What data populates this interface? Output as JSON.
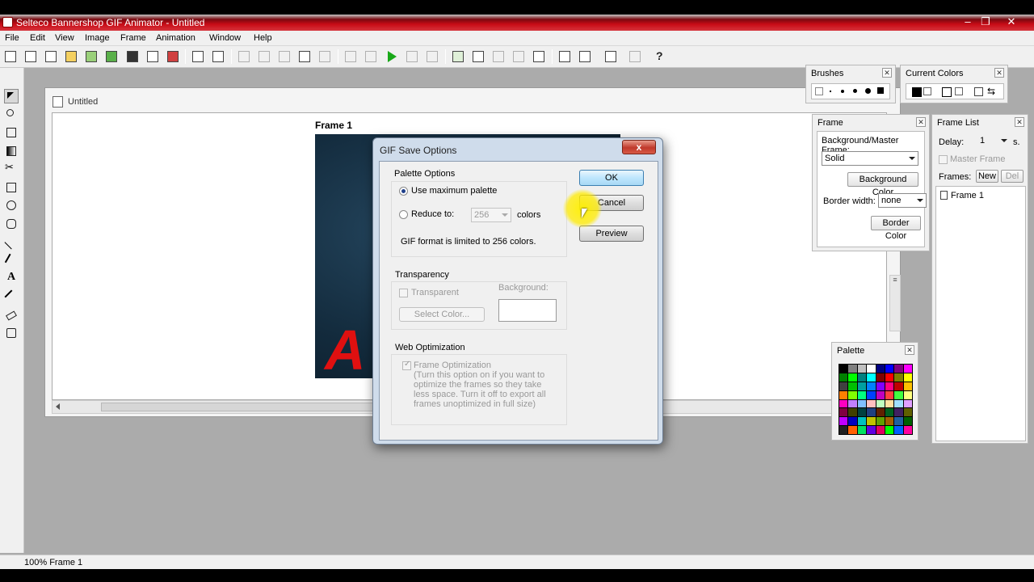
{
  "window": {
    "title": "Selteco Bannershop GIF Animator - Untitled",
    "min": "–",
    "max": "❐",
    "close": "✕"
  },
  "menu": [
    "File",
    "Edit",
    "View",
    "Image",
    "Frame",
    "Animation",
    "Window",
    "Help"
  ],
  "document": {
    "title": "Untitled",
    "frame_label": "Frame 1",
    "banner_text": "A"
  },
  "brushes_panel": {
    "title": "Brushes"
  },
  "current_colors_panel": {
    "title": "Current Colors"
  },
  "frame_panel": {
    "title": "Frame",
    "bg_label": "Background/Master Frame:",
    "bg_value": "Solid",
    "bg_color_button": "Background Color",
    "border_width_label": "Border width:",
    "border_width_value": "none",
    "border_color_button": "Border Color"
  },
  "frame_list_panel": {
    "title": "Frame List",
    "delay_label": "Delay:",
    "delay_value": "1",
    "delay_unit": "s.",
    "master_frame": "Master Frame",
    "frames_label": "Frames:",
    "new_button": "New",
    "del_button": "Del",
    "items": [
      "Frame 1"
    ]
  },
  "palette_panel": {
    "title": "Palette",
    "colors": [
      "#000000",
      "#808080",
      "#c0c0c0",
      "#ffffff",
      "#000080",
      "#0000ff",
      "#800080",
      "#ff00ff",
      "#008000",
      "#00ff00",
      "#008080",
      "#00ffff",
      "#800000",
      "#ff0000",
      "#808000",
      "#ffff00",
      "#404040",
      "#00c000",
      "#00a0a0",
      "#0080ff",
      "#8000ff",
      "#ff0080",
      "#c00000",
      "#ffc000",
      "#ff8000",
      "#80ff00",
      "#00ff80",
      "#0040ff",
      "#c000c0",
      "#ff4040",
      "#40ff40",
      "#ffff80",
      "#ff00c0",
      "#c080ff",
      "#80c0ff",
      "#ffc0c0",
      "#c0ffc0",
      "#ffe0a0",
      "#a0e0ff",
      "#e0a0ff",
      "#800040",
      "#404000",
      "#004040",
      "#204080",
      "#602000",
      "#006020",
      "#402060",
      "#606000",
      "#c000ff",
      "#0000c0",
      "#00c0c0",
      "#c0c000",
      "#60a000",
      "#a06000",
      "#2060a0",
      "#006000",
      "#202020",
      "#ff6000",
      "#00e060",
      "#6000e0",
      "#e00060",
      "#00ff00",
      "#0060ff",
      "#ff00a0"
    ]
  },
  "dialog": {
    "title": "GIF Save Options",
    "close": "x",
    "palette_options": {
      "title": "Palette Options",
      "use_max": "Use maximum palette",
      "reduce_to": "Reduce to:",
      "reduce_value": "256",
      "colors_label": "colors",
      "note": "GIF format is limited to 256 colors."
    },
    "transparency": {
      "title": "Transparency",
      "transparent": "Transparent",
      "background_label": "Background:",
      "select_color": "Select Color..."
    },
    "web_optimization": {
      "title": "Web Optimization",
      "frame_opt": "Frame Optimization",
      "description": "(Turn this option on if you want to optimize the frames so they take less space. Turn it off to export all frames unoptimized in full size)"
    },
    "buttons": {
      "ok": "OK",
      "cancel": "Cancel",
      "preview": "Preview"
    }
  },
  "status": {
    "text": "100% Frame 1"
  }
}
